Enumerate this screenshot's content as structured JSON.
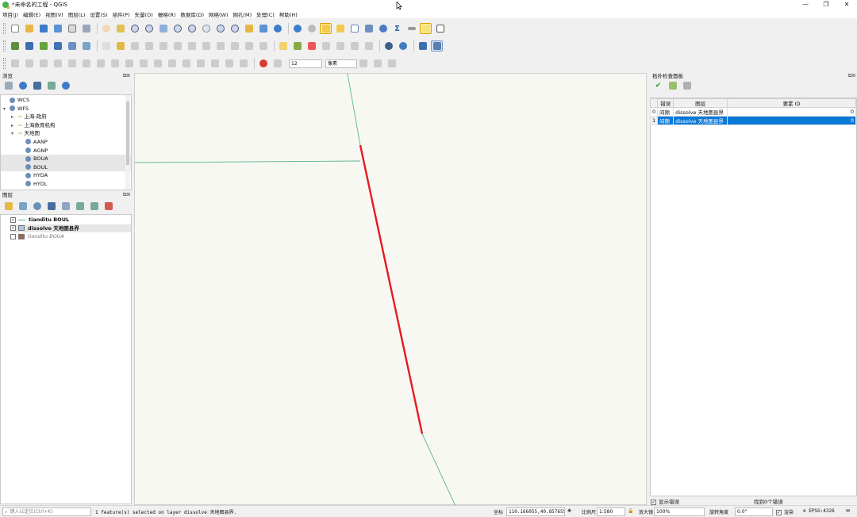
{
  "window": {
    "title": "*未命名的工程 - QGIS",
    "minimize": "—",
    "maximize": "❐",
    "close": "✕"
  },
  "menu": [
    "项目(J)",
    "编辑(E)",
    "视图(V)",
    "图层(L)",
    "设置(S)",
    "插件(P)",
    "矢量(O)",
    "栅格(R)",
    "数据库(D)",
    "网络(W)",
    "网孔(M)",
    "处理(C)",
    "帮助(H)"
  ],
  "toolbar3": {
    "snap_tolerance": "12",
    "snap_unit": "像素"
  },
  "browser_panel": {
    "title": "浏览",
    "items": [
      {
        "label": "WCS",
        "indent": 0,
        "arrow": "",
        "icon": "globe-icon"
      },
      {
        "label": "WFS",
        "indent": 0,
        "arrow": "▾",
        "icon": "globe-icon"
      },
      {
        "label": "上海-政府",
        "indent": 1,
        "arrow": "▸",
        "icon": "wfs-connection-icon"
      },
      {
        "label": "上海数育机构",
        "indent": 1,
        "arrow": "▸",
        "icon": "wfs-connection-icon"
      },
      {
        "label": "天地图",
        "indent": 1,
        "arrow": "▾",
        "icon": "wfs-connection-icon"
      },
      {
        "label": "AANP",
        "indent": 2,
        "arrow": "",
        "icon": "wfs-layer-icon"
      },
      {
        "label": "AGNP",
        "indent": 2,
        "arrow": "",
        "icon": "wfs-layer-icon"
      },
      {
        "label": "BOUA",
        "indent": 2,
        "arrow": "",
        "icon": "wfs-layer-icon"
      },
      {
        "label": "BOUL",
        "indent": 2,
        "arrow": "",
        "icon": "wfs-layer-icon"
      },
      {
        "label": "HYDA",
        "indent": 2,
        "arrow": "",
        "icon": "wfs-layer-icon"
      },
      {
        "label": "HYDL",
        "indent": 2,
        "arrow": "",
        "icon": "wfs-layer-icon"
      }
    ]
  },
  "layers_panel": {
    "title": "图层",
    "layers": [
      {
        "label": "tianditu BOUL",
        "checked": true,
        "symbol": "line",
        "color": "#5ab58f",
        "style": "bold"
      },
      {
        "label": "dissolve 天地图县界",
        "checked": true,
        "symbol": "fill",
        "color": "#a9c8e8",
        "style": "bold"
      },
      {
        "label": "tianditu BOUA",
        "checked": false,
        "symbol": "fill",
        "color": "#9c6b4e",
        "style": "italic"
      }
    ]
  },
  "topology_panel": {
    "title": "拓扑检查面板",
    "columns": [
      "错误",
      "图层",
      "要素 ID"
    ],
    "rows": [
      {
        "index": "0",
        "error": "间隙",
        "layer": "dissolve 天地图县界",
        "feature_id": "0",
        "selected": false
      },
      {
        "index": "1",
        "error": "间隙",
        "layer": "dissolve 天地图县界",
        "feature_id": "0",
        "selected": true
      }
    ],
    "show_errors_label": "显示错误",
    "error_count_label": "找到0个错误"
  },
  "map": {
    "boundary_color": "#5ab58f",
    "highlight_color": "#e8191f"
  },
  "statusbar": {
    "locate_placeholder": "键入以定位(Ctrl+K)",
    "message": "1 feature(s) selected on layer dissolve 天地图县界.",
    "coord_label": "坐标",
    "coord_value": "110.166055,40.857655",
    "scale_label": "比例尺",
    "scale_value": "1:580",
    "magnifier_label": "放大镜",
    "magnifier_value": "100%",
    "rotation_label": "旋转角度",
    "rotation_value": "0.0°",
    "render_label": "渲染",
    "crs_label": "EPSG:4326"
  }
}
